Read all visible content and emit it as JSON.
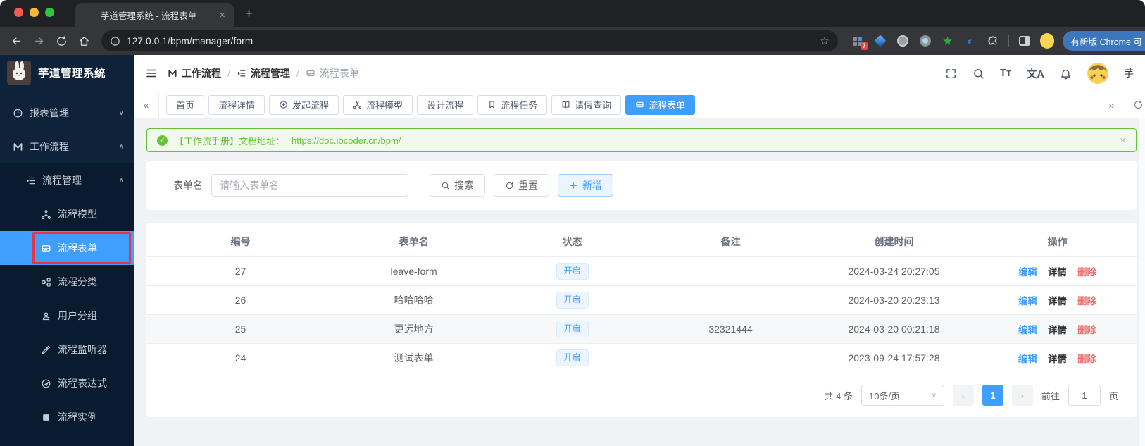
{
  "colors": {
    "accent": "#409eff",
    "success": "#67c23a",
    "danger": "#f56c6c",
    "sidebar_bg": "#0e2239",
    "annotation_red": "#e0354b"
  },
  "browser": {
    "tab_title": "芋道管理系统 - 流程表单",
    "close_glyph": "×",
    "newtab_glyph": "+",
    "url": "127.0.0.1/bpm/manager/form",
    "star_glyph": "☆",
    "ext_badge": "7",
    "update_chip": "有新版 Chrome 可"
  },
  "sidebar": {
    "logo_title": "芋道管理系统",
    "items": [
      {
        "label": "报表管理",
        "chevron": "∨"
      },
      {
        "label": "工作流程",
        "chevron": "∧"
      },
      {
        "label": "流程管理",
        "chevron": "∧"
      },
      {
        "label": "流程模型"
      },
      {
        "label": "流程表单"
      },
      {
        "label": "流程分类"
      },
      {
        "label": "用户分组"
      },
      {
        "label": "流程监听器"
      },
      {
        "label": "流程表达式"
      },
      {
        "label": "流程实例"
      }
    ]
  },
  "header": {
    "breadcrumb": [
      "工作流程",
      "流程管理",
      "流程表单"
    ],
    "separator": "/",
    "font_icon": "Tт",
    "locale_icon": "文A",
    "username_partial": "芋"
  },
  "tabsbar": {
    "left_chevrons": "«",
    "right_chevrons": "»",
    "tabs": [
      {
        "label": "首页"
      },
      {
        "label": "流程详情"
      },
      {
        "label": "发起流程"
      },
      {
        "label": "流程模型"
      },
      {
        "label": "设计流程"
      },
      {
        "label": "流程任务"
      },
      {
        "label": "请假查询"
      },
      {
        "label": "流程表单"
      }
    ]
  },
  "alert": {
    "check_glyph": "✓",
    "text": "【工作流手册】文档地址：",
    "link": "https://doc.iocoder.cn/bpm/",
    "close_glyph": "×"
  },
  "search": {
    "label": "表单名",
    "placeholder": "请输入表单名",
    "search_btn": "搜索",
    "reset_btn": "重置",
    "add_btn": "新增"
  },
  "table": {
    "columns": [
      "编号",
      "表单名",
      "状态",
      "备注",
      "创建时间",
      "操作"
    ],
    "actions": {
      "edit": "编辑",
      "detail": "详情",
      "delete": "删除"
    },
    "rows": [
      {
        "id": "27",
        "name": "leave-form",
        "status": "开启",
        "remark": "",
        "created": "2024-03-24 20:27:05"
      },
      {
        "id": "26",
        "name": "哈哈哈哈",
        "status": "开启",
        "remark": "",
        "created": "2024-03-20 20:23:13"
      },
      {
        "id": "25",
        "name": "更远地方",
        "status": "开启",
        "remark": "32321444",
        "created": "2024-03-20 00:21:18"
      },
      {
        "id": "24",
        "name": "测试表单",
        "status": "开启",
        "remark": "",
        "created": "2023-09-24 17:57:28"
      }
    ]
  },
  "pagination": {
    "total": "共 4 条",
    "per_page": "10条/页",
    "prev": "‹",
    "next": "›",
    "page": "1",
    "goto_label": "前往",
    "goto_value": "1",
    "page_suffix": "页"
  }
}
